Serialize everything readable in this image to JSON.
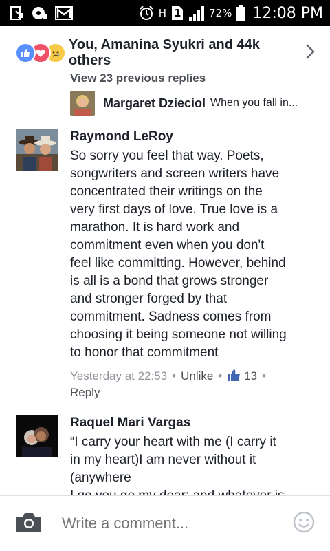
{
  "status_bar": {
    "battery": "72%",
    "time": "12:08 PM",
    "network_letter": "H",
    "sim_number": "1",
    "icons": [
      "download-icon",
      "sync-icon",
      "gmail-icon",
      "alarm-icon",
      "signal-icon",
      "battery-icon"
    ]
  },
  "header": {
    "reactions_text": "You, Amanina Syukri and 44k others",
    "reaction_icons": [
      "like-reaction-icon",
      "love-reaction-icon",
      "sad-reaction-icon"
    ]
  },
  "thread": {
    "view_previous": "View 23 previous replies",
    "reply_preview": {
      "name": "Margaret Dzieciol",
      "text": "When you fall in..."
    }
  },
  "comments": [
    {
      "name": "Raymond LeRoy",
      "text": "So sorry you feel that way. Poets,\nsongwriters and screen writers have\nconcentrated their writings on the\nvery first days of love. True love is a\nmarathon. It is hard work and\ncommitment even when you don't\nfeel like committing. However, behind\nis all is a bond that grows stronger\nand stronger forged by that\ncommitment. Sadness comes from\nchoosing it being someone not willing\nto honor that commitment",
      "time": "Yesterday at 22:53",
      "unlike": "Unlike",
      "likes": "13",
      "reply": "Reply"
    },
    {
      "name": "Raquel Mari Vargas",
      "text": "“I carry your heart with me (I carry it\nin my heart)I am never without it\n(anywhere\nI go you go my dear; and whatever is"
    }
  ],
  "composer": {
    "placeholder": "Write a comment..."
  },
  "colors": {
    "brand_blue": "#4267b2",
    "meta_gray": "#90949c"
  }
}
